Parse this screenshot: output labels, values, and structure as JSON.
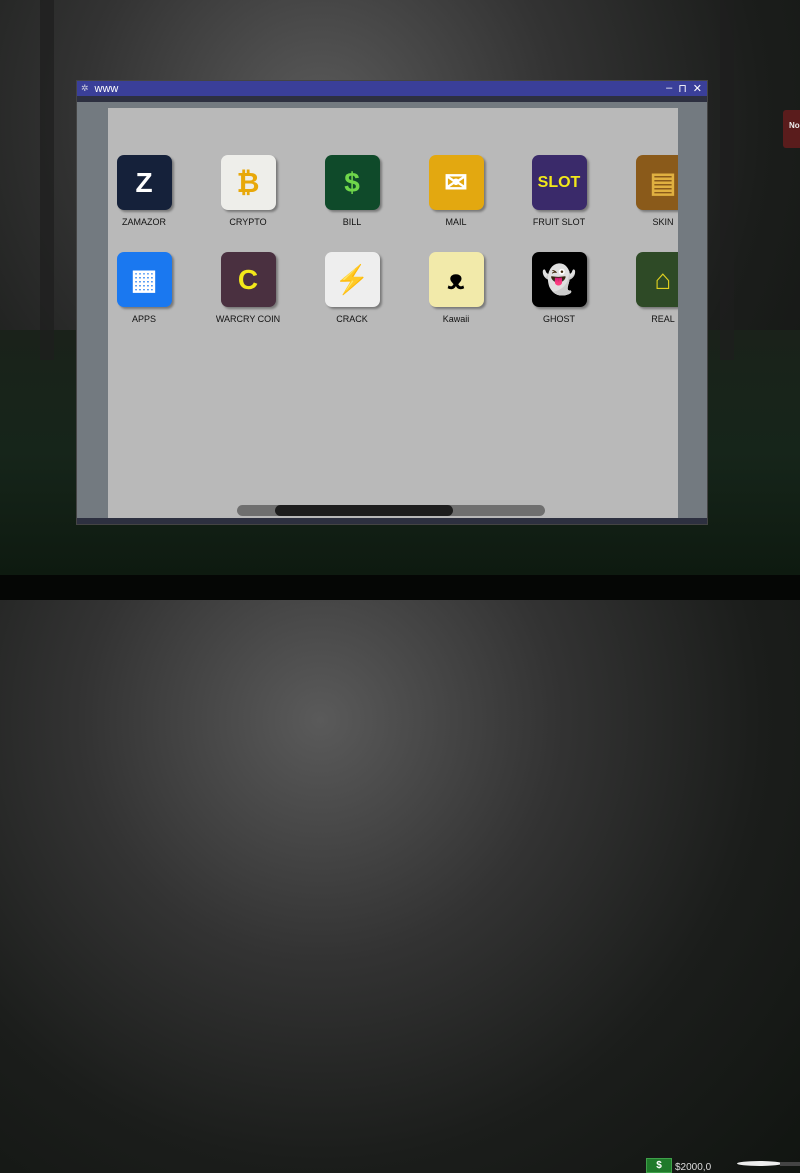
{
  "window": {
    "title": "www",
    "controls": [
      "–",
      "⊓",
      "✕"
    ]
  },
  "apps": [
    {
      "label": "ZAMAZOR",
      "icon": "zamazor-icon",
      "glyph": "Z",
      "bg": "#15213a",
      "fg": "#fff"
    },
    {
      "label": "CRYPTO",
      "icon": "bitcoin-icon",
      "glyph": "₿",
      "bg": "#eeeeea",
      "fg": "#e8a80a"
    },
    {
      "label": "BILL",
      "icon": "cash-icon",
      "glyph": "$",
      "bg": "#0f4a2a",
      "fg": "#6fd64a"
    },
    {
      "label": "MAIL",
      "icon": "envelope-icon",
      "glyph": "✉",
      "bg": "#e3a810",
      "fg": "#fff"
    },
    {
      "label": "FRUIT SLOT",
      "icon": "fruit-slot-icon",
      "glyph": "SLOT",
      "bg": "#3a2a6a",
      "fg": "#f2e81a"
    },
    {
      "label": "SKIN",
      "icon": "chest-icon",
      "glyph": "▤",
      "bg": "#8a5a1a",
      "fg": "#e0b040"
    },
    {
      "label": "APPS",
      "icon": "calendar-icon",
      "glyph": "▦",
      "bg": "#1a78f0",
      "fg": "#fff"
    },
    {
      "label": "WARCRY COIN",
      "icon": "warrior-coin-icon",
      "glyph": "C",
      "bg": "#4a3040",
      "fg": "#f2e81a"
    },
    {
      "label": "CRACK",
      "icon": "cracked-document-icon",
      "glyph": "⚡",
      "bg": "#eeeeee",
      "fg": "#000"
    },
    {
      "label": "Kawaii",
      "icon": "bear-face-icon",
      "glyph": "ᴥ",
      "bg": "#f2eaaa",
      "fg": "#000"
    },
    {
      "label": "GHOST",
      "icon": "ghost-icon",
      "glyph": "👻",
      "bg": "#000",
      "fg": "#fff"
    },
    {
      "label": "REAL",
      "icon": "house-icon",
      "glyph": "⌂",
      "bg": "#2e4a26",
      "fg": "#e0d020"
    }
  ],
  "taskbar": {
    "money_icon": "$",
    "money": "$2000,0"
  },
  "notification": {
    "text": "No"
  }
}
